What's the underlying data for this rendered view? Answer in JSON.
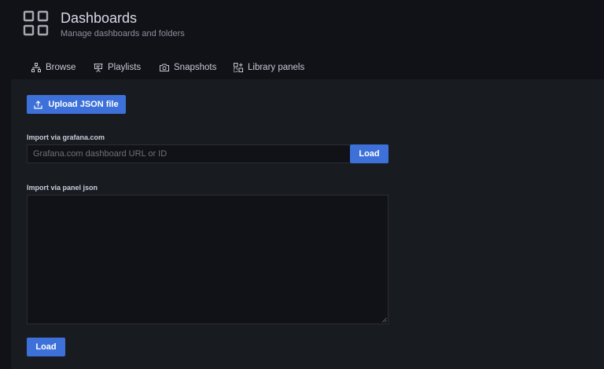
{
  "header": {
    "title": "Dashboards",
    "subtitle": "Manage dashboards and folders",
    "icon": "dashboard-grid-icon"
  },
  "tabs": [
    {
      "label": "Browse",
      "icon": "sitemap-icon"
    },
    {
      "label": "Playlists",
      "icon": "presentation-icon"
    },
    {
      "label": "Snapshots",
      "icon": "camera-icon"
    },
    {
      "label": "Library panels",
      "icon": "library-panel-icon"
    }
  ],
  "import": {
    "upload_label": "Upload JSON file",
    "grafana_label": "Import via grafana.com",
    "grafana_placeholder": "Grafana.com dashboard URL or ID",
    "load_label": "Load",
    "json_label": "Import via panel json",
    "json_value": "",
    "load2_label": "Load"
  },
  "colors": {
    "primary": "#3d71d9",
    "page_bg": "#111217",
    "content_bg": "#181b1f"
  }
}
